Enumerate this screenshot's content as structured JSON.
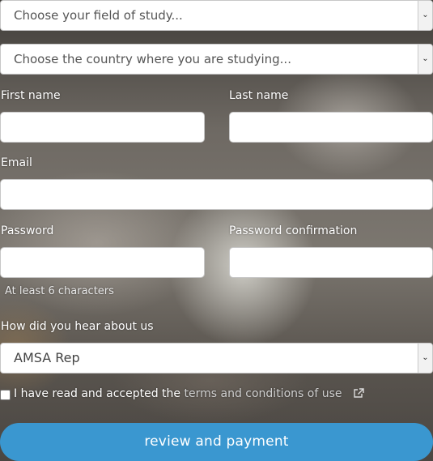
{
  "field_of_study": {
    "placeholder": "Choose your field of study..."
  },
  "country": {
    "placeholder": "Choose the country where you are studying..."
  },
  "first_name": {
    "label": "First name",
    "value": ""
  },
  "last_name": {
    "label": "Last name",
    "value": ""
  },
  "email": {
    "label": "Email",
    "value": ""
  },
  "password": {
    "label": "Password",
    "value": "",
    "hint": "At least 6 characters"
  },
  "password_confirmation": {
    "label": "Password confirmation",
    "value": ""
  },
  "referral": {
    "label": "How did you hear about us",
    "selected": "AMSA Rep"
  },
  "terms": {
    "checked": false,
    "text": "I have read and accepted the",
    "link_text": "terms and conditions of use"
  },
  "submit": {
    "label": "review and payment"
  },
  "icons": {
    "select_arrow": "chevron-down-icon",
    "external_link": "external-link-icon"
  },
  "colors": {
    "submit_button": "#3a97d0",
    "label_text": "#ffffff",
    "link_text": "#cfcfcf"
  }
}
